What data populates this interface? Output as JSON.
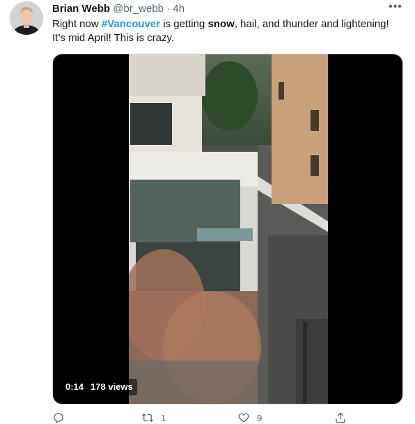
{
  "tweet": {
    "author": {
      "name": "Brian Webb",
      "handle": "@br_webb",
      "separator": "·",
      "time": "4h"
    },
    "text": {
      "part1": "Right now ",
      "hashtag": "#Vancouver",
      "part2": " is getting ",
      "bold": "snow",
      "part3": ", hail, and thunder and lightening! It’s mid April! This is crazy."
    },
    "video": {
      "duration": "0:14",
      "views": "178 views"
    },
    "actions": {
      "reply": {
        "icon": "reply-icon",
        "count": ""
      },
      "retweet": {
        "icon": "retweet-icon",
        "count": "1"
      },
      "like": {
        "icon": "heart-icon",
        "count": "9"
      },
      "share": {
        "icon": "share-icon",
        "count": ""
      }
    },
    "colors": {
      "accent": "#1d9bf0",
      "muted": "#536471",
      "text": "#0f1419"
    }
  }
}
